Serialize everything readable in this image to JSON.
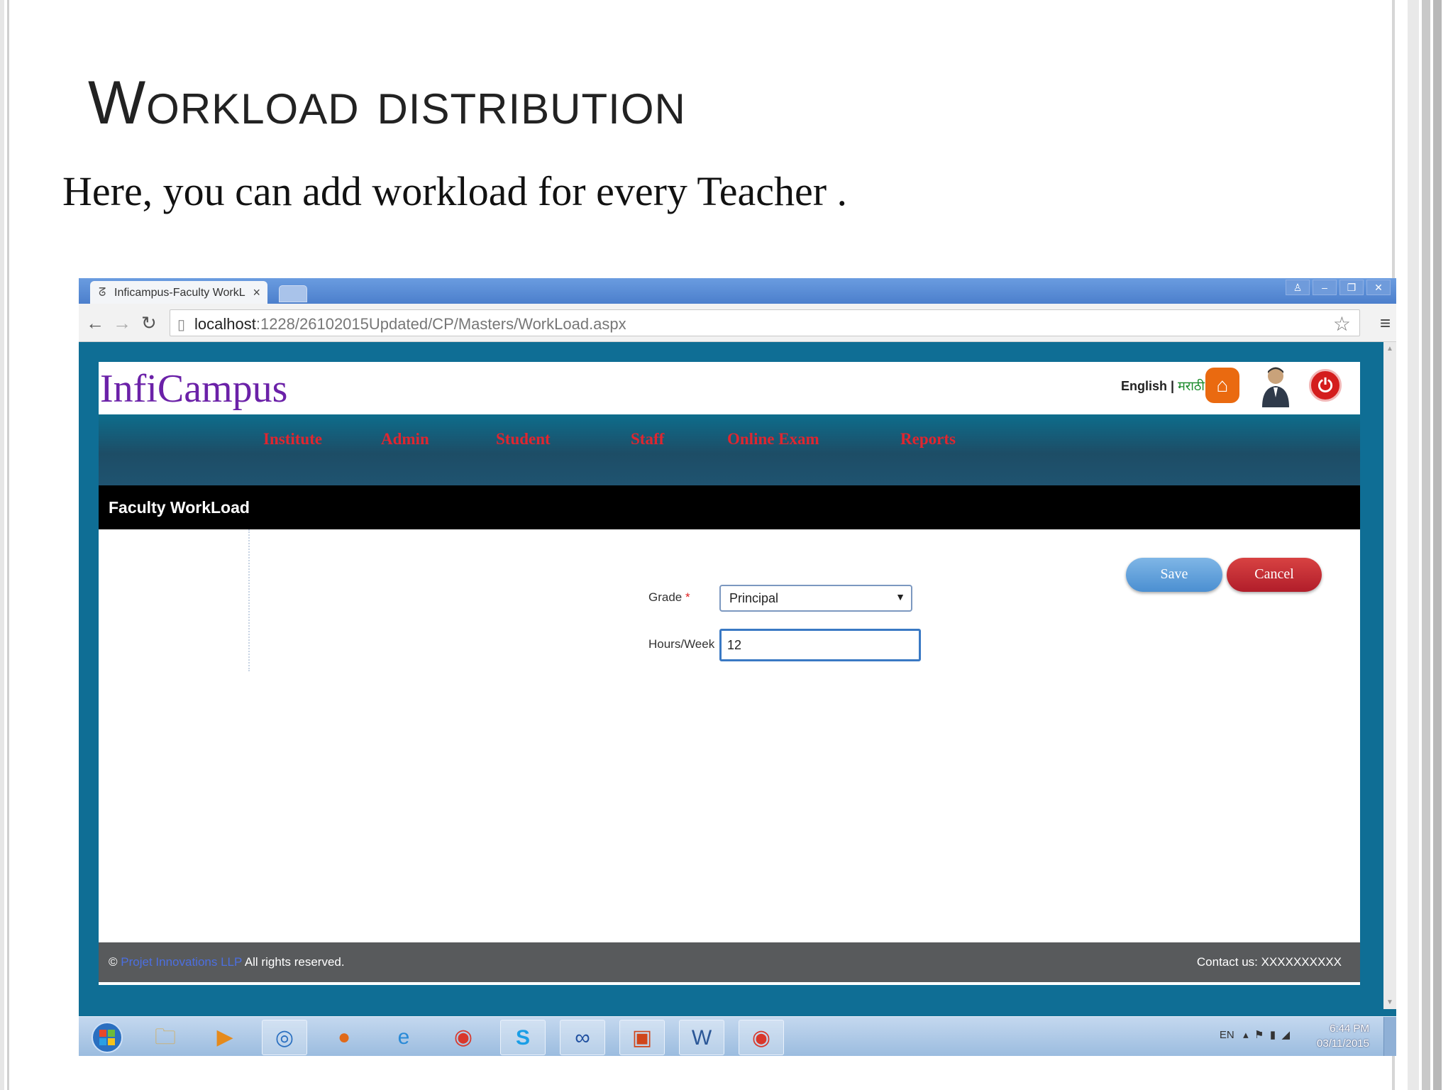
{
  "slide": {
    "title": "Workload distribution",
    "subtitle": "Here, you can add workload for every Teacher ."
  },
  "browser": {
    "tab_title": "Inficampus-Faculty WorkL",
    "tab_close": "×",
    "url_host": "localhost",
    "url_path": ":1228/26102015Updated/CP/Masters/WorkLoad.aspx"
  },
  "app": {
    "logo": "InfiCampus",
    "lang_english": "English",
    "lang_sep": " | ",
    "lang_marathi": "मराठी",
    "menu": [
      "Institute",
      "Admin",
      "Student",
      "Staff",
      "Online Exam",
      "Reports"
    ],
    "page_title": "Faculty WorkLoad",
    "form": {
      "grade_label": "Grade",
      "grade_required": "*",
      "grade_value": "Principal",
      "hours_label": "Hours/Week",
      "hours_value": "12"
    },
    "buttons": {
      "save": "Save",
      "cancel": "Cancel"
    },
    "footer": {
      "copyright_symbol": "©",
      "company": "Projet Innovations LLP",
      "rights": "All rights reserved.",
      "contact": "Contact us:   XXXXXXXXXX"
    }
  },
  "taskbar": {
    "lang": "EN",
    "time": "6:44 PM",
    "date": "03/11/2015"
  },
  "colors": {
    "frame_blue": "#0f6e95",
    "menu_red": "#e0262f",
    "logo_purple": "#6b21a8",
    "save_blue": "#4b8fd1",
    "cancel_red": "#b11d2a"
  }
}
